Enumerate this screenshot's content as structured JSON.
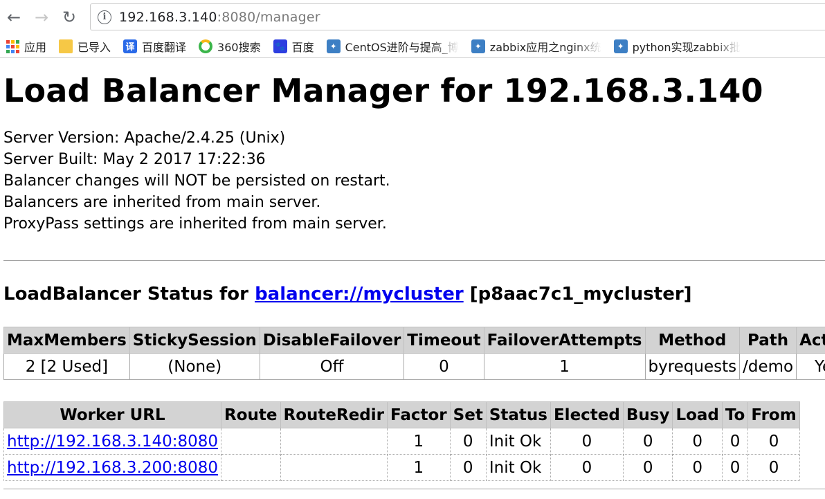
{
  "browser": {
    "url_host": "192.168.3.140",
    "url_rest": ":8080/manager",
    "bookmarks": [
      {
        "label": "应用"
      },
      {
        "label": "已导入"
      },
      {
        "label": "百度翻译",
        "icon_char": "译"
      },
      {
        "label": "360搜索"
      },
      {
        "label": "百度",
        "icon_char": "🐾"
      },
      {
        "label": "CentOS进阶与提高_博"
      },
      {
        "label": "zabbix应用之nginx统"
      },
      {
        "label": "python实现zabbix批"
      }
    ]
  },
  "page": {
    "title": "Load Balancer Manager for 192.168.3.140",
    "info_lines": [
      "Server Version: Apache/2.4.25 (Unix)",
      "Server Built: May 2 2017 17:22:36",
      "Balancer changes will NOT be persisted on restart.",
      "Balancers are inherited from main server.",
      "ProxyPass settings are inherited from main server."
    ],
    "status_prefix": "LoadBalancer Status for ",
    "balancer_link": "balancer://mycluster",
    "balancer_id": " [p8aac7c1_mycluster]"
  },
  "balancer_table": {
    "headers": [
      "MaxMembers",
      "StickySession",
      "DisableFailover",
      "Timeout",
      "FailoverAttempts",
      "Method",
      "Path",
      "Active"
    ],
    "row": [
      "2 [2 Used]",
      "(None)",
      "Off",
      "0",
      "1",
      "byrequests",
      "/demo",
      "Yes"
    ]
  },
  "worker_table": {
    "headers": [
      "Worker URL",
      "Route",
      "RouteRedir",
      "Factor",
      "Set",
      "Status",
      "Elected",
      "Busy",
      "Load",
      "To",
      "From"
    ],
    "rows": [
      [
        "http://192.168.3.140:8080",
        "",
        "",
        "1",
        "0",
        "Init Ok",
        "0",
        "0",
        "0",
        "0",
        "0"
      ],
      [
        "http://192.168.3.200:8080",
        "",
        "",
        "1",
        "0",
        "Init Ok",
        "0",
        "0",
        "0",
        "0",
        "0"
      ]
    ]
  }
}
